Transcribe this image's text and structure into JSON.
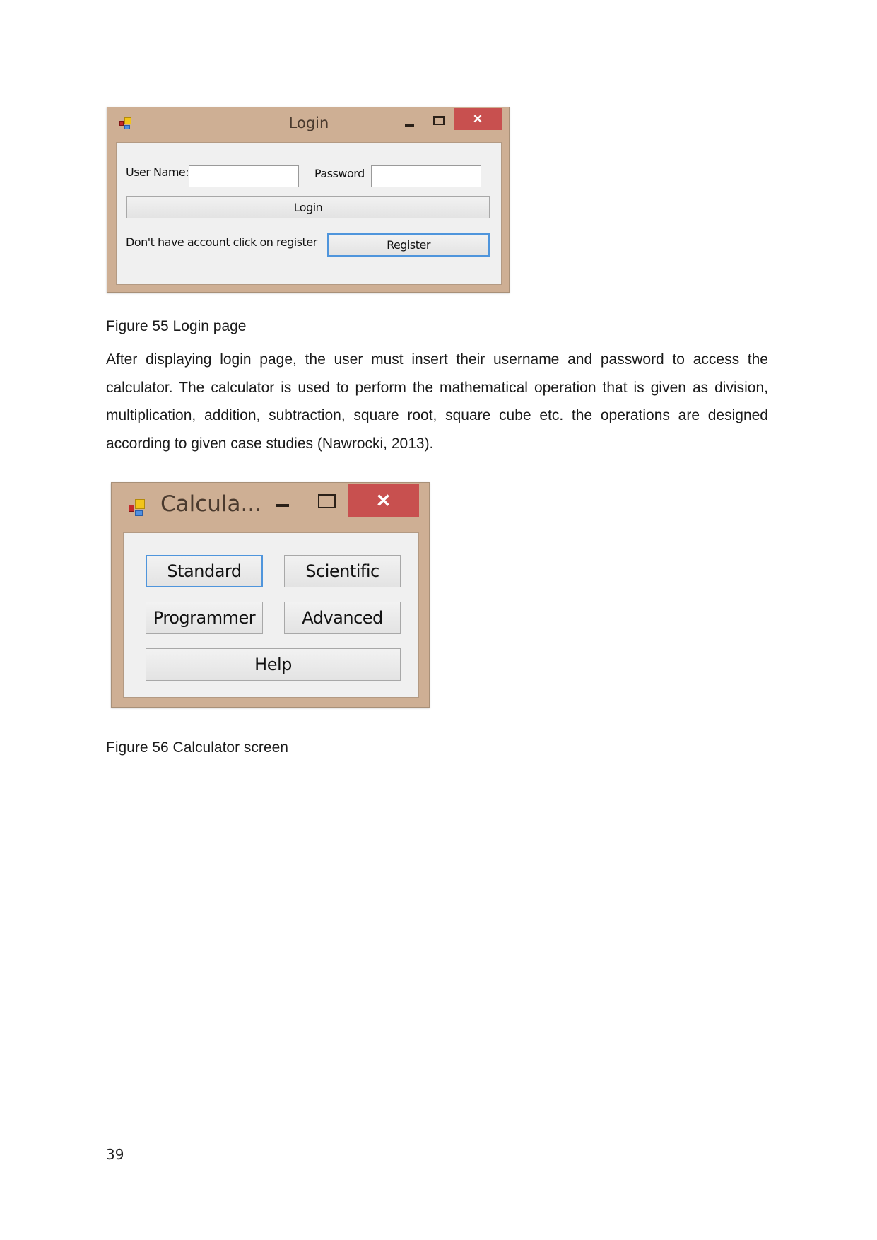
{
  "figures": [
    {
      "caption": "Figure 55 Login page",
      "window": {
        "title": "Login",
        "icons": {
          "app": "app-icon",
          "minimize": "minimize-icon",
          "maximize": "maximize-icon",
          "close": "close-icon"
        },
        "close_glyph": "✕",
        "fields": [
          {
            "label": "User Name:",
            "value": "",
            "placeholder": ""
          },
          {
            "label": "Password",
            "value": "",
            "placeholder": ""
          }
        ],
        "login_button": "Login",
        "register_prompt": "Don't have account click on register",
        "register_button": "Register"
      }
    },
    {
      "caption": "Figure 56 Calculator screen",
      "window": {
        "title": "Calcula...",
        "icons": {
          "app": "app-icon",
          "minimize": "minimize-icon",
          "maximize": "maximize-icon",
          "close": "close-icon"
        },
        "close_glyph": "✕",
        "buttons": [
          "Standard",
          "Scientific",
          "Programmer",
          "Advanced",
          "Help"
        ]
      }
    }
  ],
  "body_text": "After displaying login page, the user must insert their username and password to access the calculator. The calculator is used to perform the mathematical operation that is given as division, multiplication, addition, subtraction, square root, square cube etc. the operations are designed according to given case studies (Nawrocki, 2013).",
  "page_number": "39",
  "colors": {
    "window_frame": "#ceaf94",
    "client_bg": "#f0f0f0",
    "close_button": "#c8504f",
    "focus_border": "#4f95dc"
  }
}
